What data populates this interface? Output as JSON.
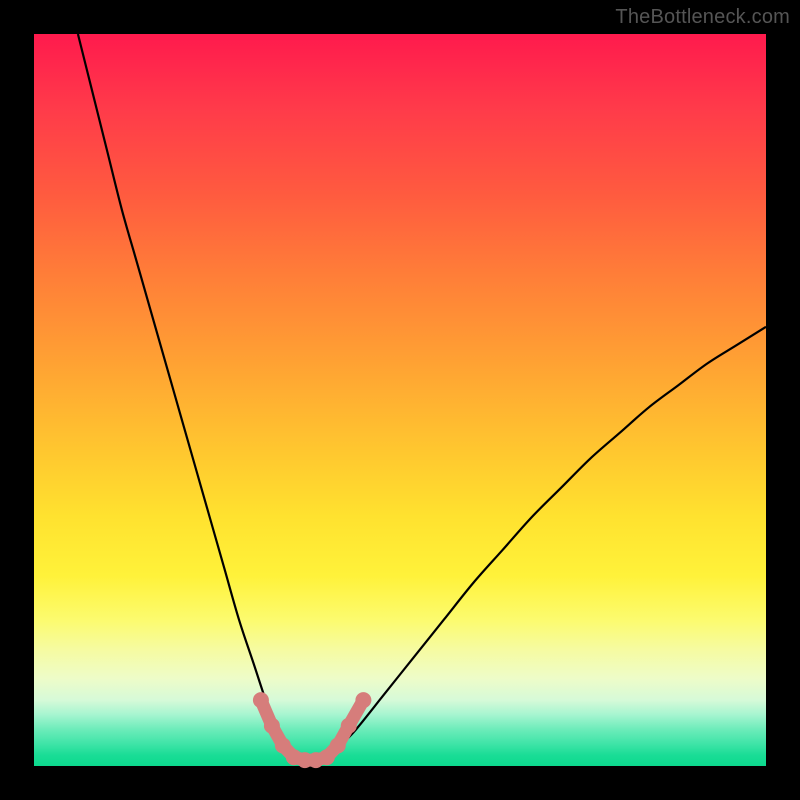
{
  "watermark": "TheBottleneck.com",
  "chart_data": {
    "type": "line",
    "title": "",
    "xlabel": "",
    "ylabel": "",
    "xlim": [
      0,
      100
    ],
    "ylim": [
      0,
      100
    ],
    "grid": false,
    "legend": false,
    "series": [
      {
        "name": "bottleneck-curve",
        "color": "#000000",
        "x": [
          6,
          8,
          10,
          12,
          14,
          16,
          18,
          20,
          22,
          24,
          26,
          28,
          30,
          32,
          33,
          34,
          35,
          36,
          37,
          38,
          40,
          42,
          44,
          48,
          52,
          56,
          60,
          64,
          68,
          72,
          76,
          80,
          84,
          88,
          92,
          96,
          100
        ],
        "y": [
          100,
          92,
          84,
          76,
          69,
          62,
          55,
          48,
          41,
          34,
          27,
          20,
          14,
          8,
          6,
          4,
          2.5,
          1.5,
          1,
          1,
          1.5,
          3,
          5,
          10,
          15,
          20,
          25,
          29.5,
          34,
          38,
          42,
          45.5,
          49,
          52,
          55,
          57.5,
          60
        ]
      },
      {
        "name": "marker-dots",
        "color": "#d67d7b",
        "type": "scatter",
        "x": [
          31,
          32.5,
          34,
          35.5,
          37,
          38.5,
          40,
          41.5,
          43,
          45
        ],
        "y": [
          9,
          5.5,
          2.8,
          1.2,
          0.8,
          0.8,
          1.2,
          2.8,
          5.5,
          9
        ]
      }
    ],
    "annotations": [
      {
        "text": "TheBottleneck.com",
        "position": "top-right"
      }
    ]
  }
}
